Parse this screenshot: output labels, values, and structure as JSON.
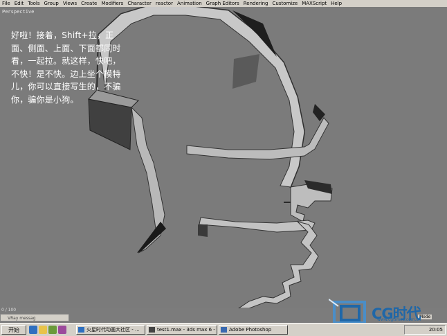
{
  "menu": [
    "File",
    "Edit",
    "Tools",
    "Group",
    "Views",
    "Create",
    "Modifiers",
    "Character",
    "reactor",
    "Animation",
    "Graph Editors",
    "Rendering",
    "Customize",
    "MAXScript",
    "Help"
  ],
  "viewport": {
    "label": "Perspective",
    "caption": "好啦！接着，Shift+拉，正面、侧面、上面、下面都同时看，一起拉。就这样，快吧，不快！是不快。边上坐个模特儿，你可以直接写生的，不骗你，骗你是小狗。"
  },
  "status": {
    "frame_counter": "0 / 100",
    "vray_message": "VRay messag",
    "mode": "Mode"
  },
  "taskbar": {
    "start_label": "开始",
    "tasks": [
      "火星时代动画大社区 - ...",
      "test1.max - 3ds max 6 - S...",
      "Adobe Photoshop"
    ],
    "clock": "20:05"
  },
  "watermark": {
    "logo": "CG时代",
    "url": "www.cgtimes.com.cn"
  },
  "colors": {
    "viewport_bg": "#7b7b7b",
    "model_face_light": "#c9c9c9",
    "model_face_dark": "#3a3a3a",
    "taskbar_bg": "#d4d0c8",
    "watermark_blue": "#1f67a8"
  }
}
